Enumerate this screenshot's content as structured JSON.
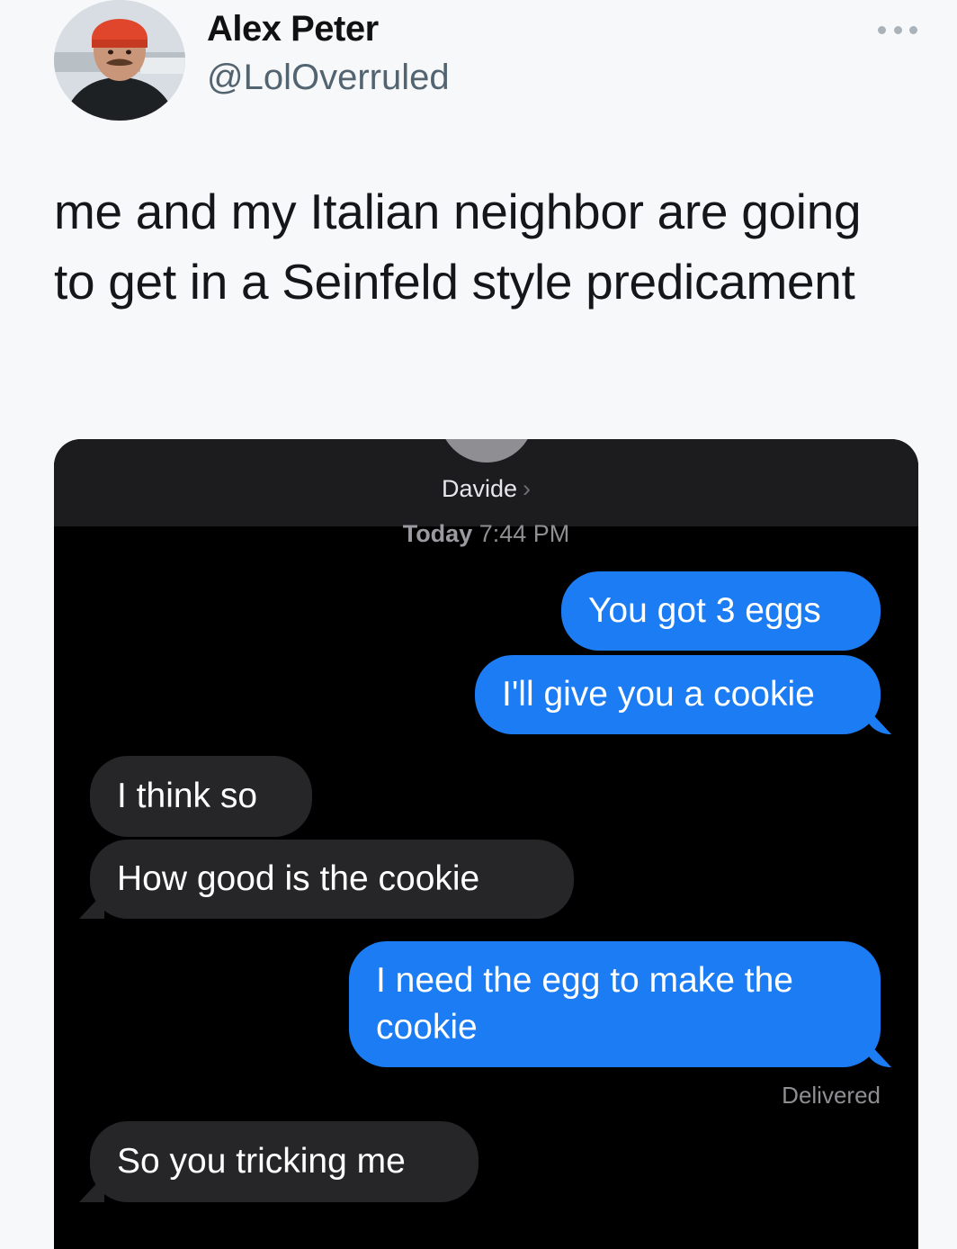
{
  "tweet": {
    "author_name": "Alex Peter",
    "author_handle": "@LolOverruled",
    "text": "me and my Italian neighbor are going to get in a Seinfeld style predicament"
  },
  "chat": {
    "contact_name": "Davide",
    "timestamp_day": "Today",
    "timestamp_time": "7:44 PM",
    "messages": [
      {
        "from": "me",
        "text": "You got 3 eggs"
      },
      {
        "from": "me",
        "text": "I'll give you a cookie"
      },
      {
        "from": "them",
        "text": "I think so"
      },
      {
        "from": "them",
        "text": "How good  is the cookie"
      },
      {
        "from": "me",
        "text": "I need the egg to make the cookie"
      },
      {
        "from": "them",
        "text": "So you tricking me"
      }
    ],
    "delivered_label": "Delivered"
  },
  "colors": {
    "outgoing_bubble": "#1c7cf4",
    "incoming_bubble": "#262629",
    "chat_background": "#000000"
  }
}
